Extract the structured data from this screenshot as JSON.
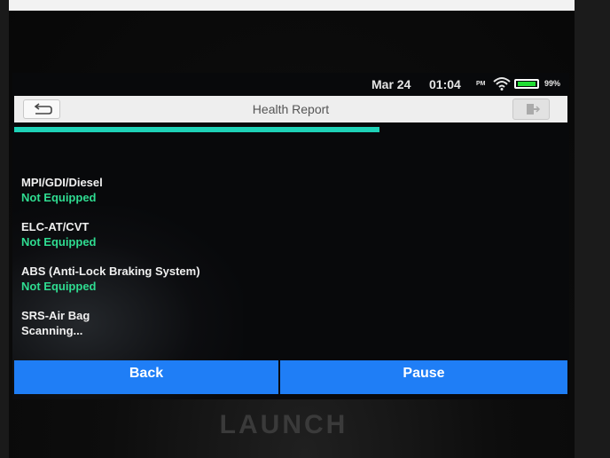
{
  "status_bar": {
    "date": "Mar 24",
    "time": "01:04",
    "ampm": "PM",
    "battery_percent": "99%",
    "battery_level": 0.99,
    "wifi_icon": "wifi-icon",
    "battery_icon": "battery-icon"
  },
  "header": {
    "title": "Health Report",
    "back_icon": "return-arrow-icon",
    "exit_icon": "exit-door-icon"
  },
  "progress": {
    "fraction": 0.66,
    "color": "#1ed2b7"
  },
  "systems": [
    {
      "name": "MPI/GDI/Diesel",
      "status": "Not Equipped",
      "state": "ok"
    },
    {
      "name": "ELC-AT/CVT",
      "status": "Not Equipped",
      "state": "ok"
    },
    {
      "name": "ABS (Anti-Lock Braking System)",
      "status": "Not Equipped",
      "state": "ok"
    },
    {
      "name": "SRS-Air Bag",
      "status": "Scanning...",
      "state": "scan"
    }
  ],
  "buttons": {
    "back": "Back",
    "pause": "Pause"
  },
  "colors": {
    "button": "#1f7ef6",
    "status_ok": "#2fdc91"
  },
  "device": {
    "brand": "LAUNCH"
  }
}
